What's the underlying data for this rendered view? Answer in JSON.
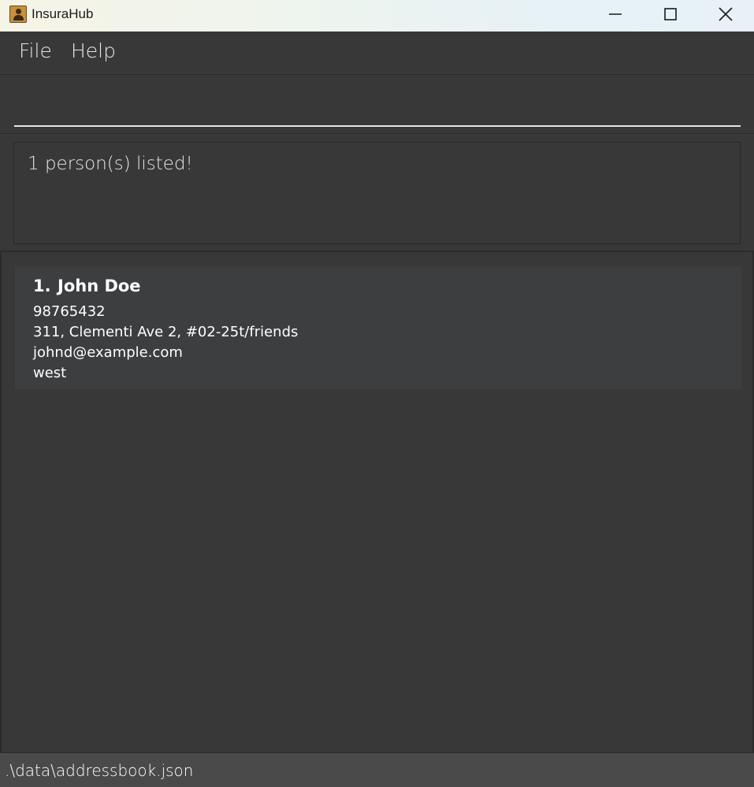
{
  "window": {
    "title": "InsuraHub",
    "app_icon": "address-book-icon",
    "controls": [
      "minimize-icon",
      "maximize-icon",
      "close-icon"
    ]
  },
  "menu": {
    "items": [
      {
        "label": "File"
      },
      {
        "label": "Help"
      }
    ]
  },
  "command_box": {
    "value": "",
    "placeholder": ""
  },
  "result_display": {
    "text": "1 person(s) listed!"
  },
  "person_list": {
    "items": [
      {
        "index": "1.",
        "name": "John Doe",
        "phone": "98765432",
        "address": "311, Clementi Ave 2, #02-25t/friends",
        "email": "johnd@example.com",
        "tag": "west"
      }
    ]
  },
  "status_bar": {
    "file_path": ".\\data\\addressbook.json"
  },
  "colors": {
    "background": "#383838",
    "card": "#3c3e3f",
    "status_bar": "#4a4a4a",
    "text": "#ffffff"
  }
}
